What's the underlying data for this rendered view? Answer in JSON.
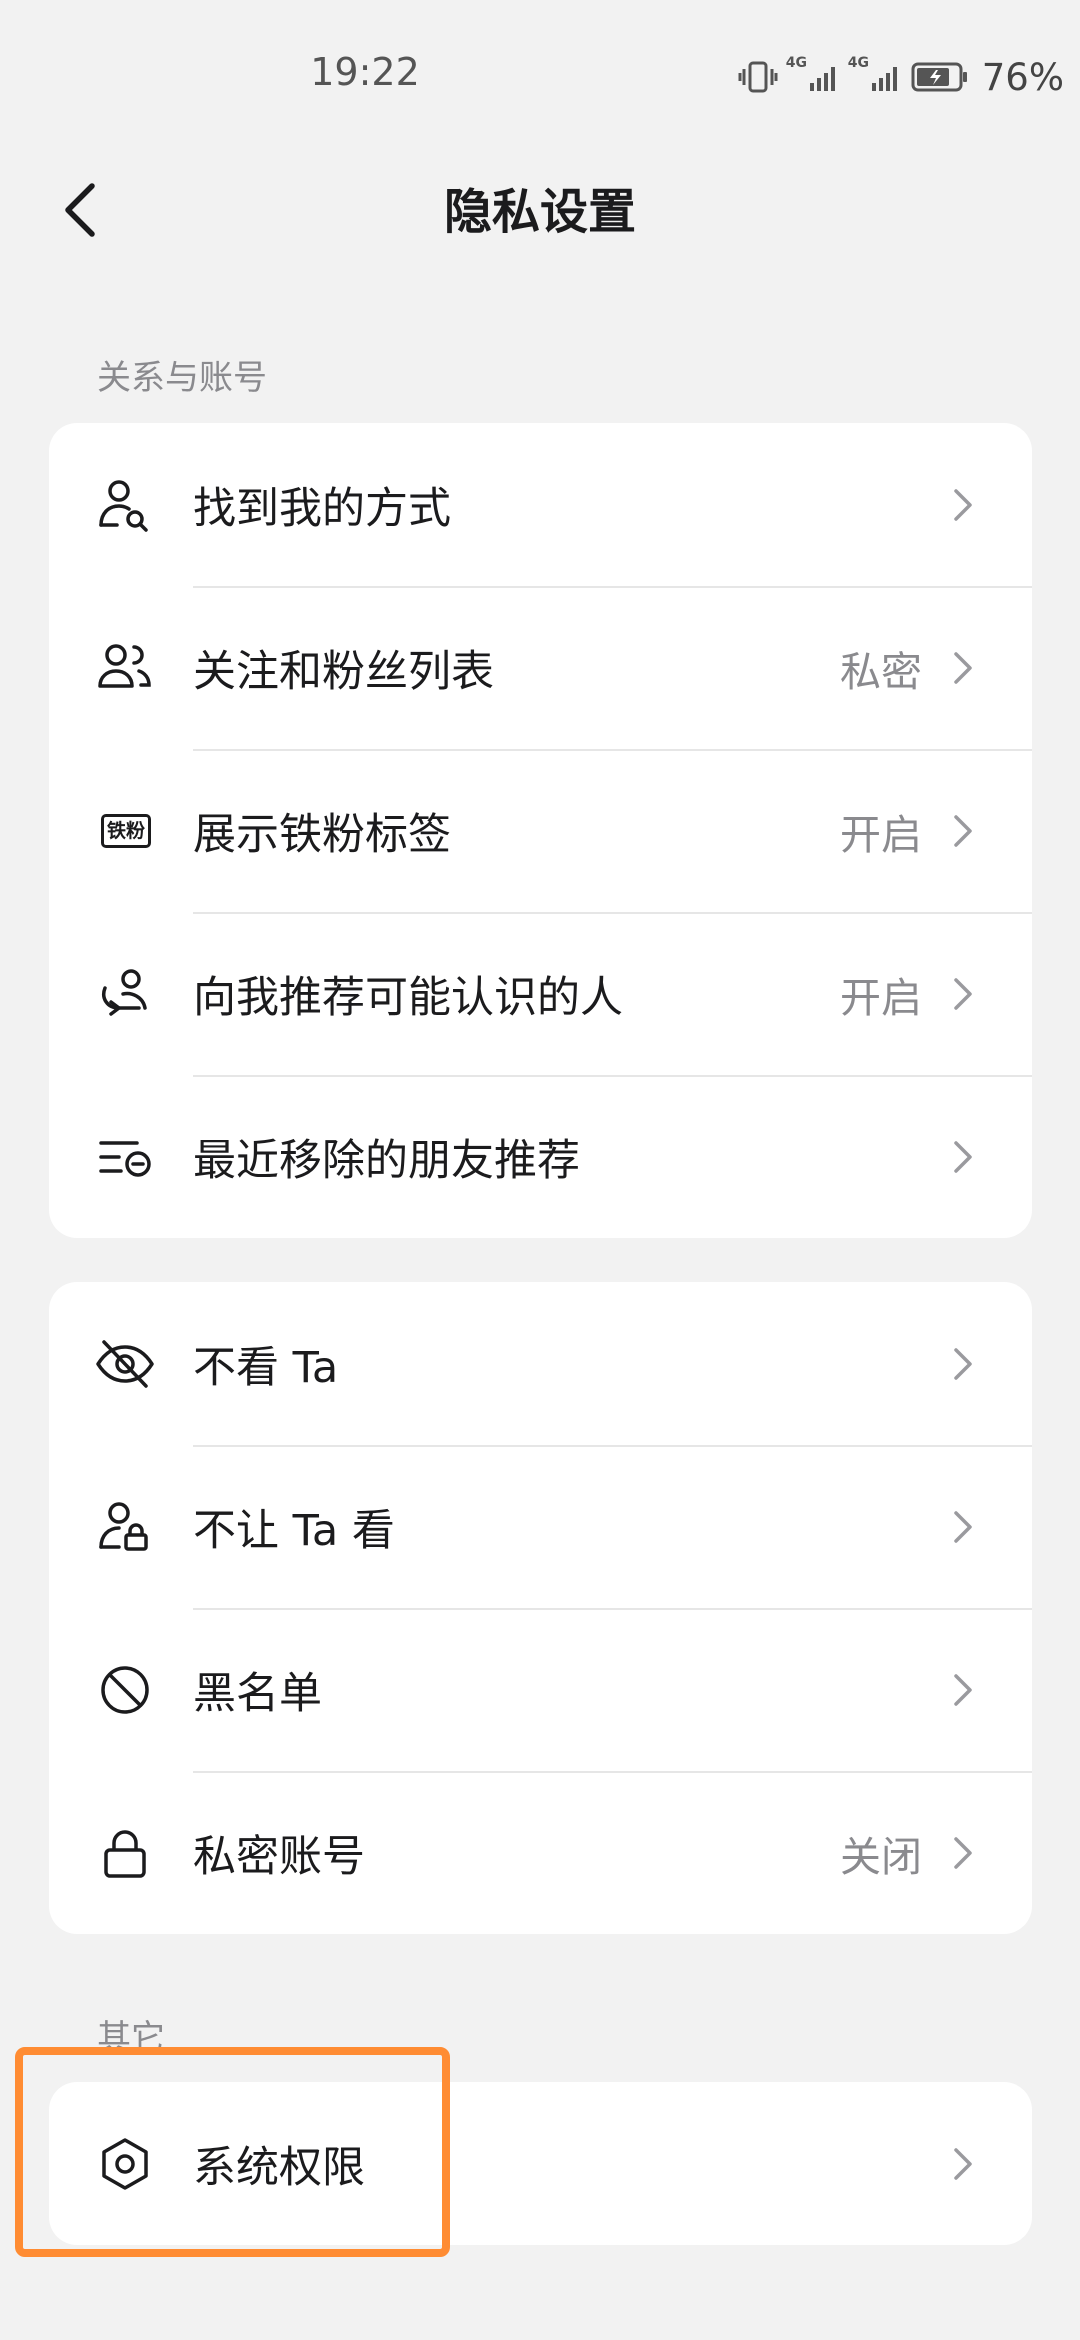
{
  "status_bar": {
    "time": "19:22",
    "network1": "4G",
    "network2": "4G",
    "battery_percent": "76%"
  },
  "nav": {
    "title": "隐私设置",
    "back_icon": "chevron-left-icon"
  },
  "section_relationship": {
    "label": "关系与账号",
    "items": [
      {
        "label": "找到我的方式",
        "value": "",
        "icon": "person-search-icon"
      },
      {
        "label": "关注和粉丝列表",
        "value": "私密",
        "icon": "people-icon"
      },
      {
        "label": "展示铁粉标签",
        "value": "开启",
        "icon": "iron-fan-badge-icon",
        "icon_text": "铁粉"
      },
      {
        "label": "向我推荐可能认识的人",
        "value": "开启",
        "icon": "person-recommend-icon"
      },
      {
        "label": "最近移除的朋友推荐",
        "value": "",
        "icon": "list-removed-icon"
      }
    ]
  },
  "section_visibility": {
    "items": [
      {
        "label": "不看 Ta",
        "value": "",
        "icon": "eye-off-icon"
      },
      {
        "label": "不让 Ta 看",
        "value": "",
        "icon": "person-lock-icon"
      },
      {
        "label": "黑名单",
        "value": "",
        "icon": "block-icon"
      },
      {
        "label": "私密账号",
        "value": "关闭",
        "icon": "lock-icon"
      }
    ]
  },
  "section_other": {
    "label": "其它",
    "items": [
      {
        "label": "系统权限",
        "value": "",
        "icon": "hexagon-settings-icon"
      }
    ]
  },
  "colors": {
    "background": "#f2f2f2",
    "card": "#ffffff",
    "secondary_text": "#8a8a8e",
    "highlight": "#ff8c33"
  }
}
